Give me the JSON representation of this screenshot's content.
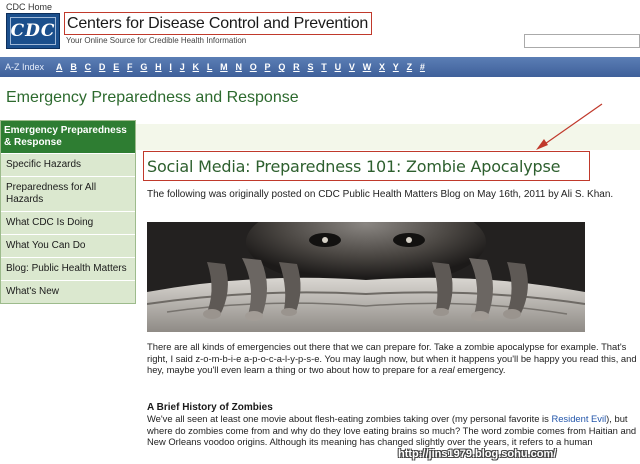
{
  "header": {
    "cdc_home": "CDC Home",
    "logo_text": "CDC",
    "site_title": "Centers for Disease Control and Prevention",
    "tagline": "Your Online Source for Credible Health Information"
  },
  "az_bar": {
    "label": "A-Z Index",
    "letters": [
      "A",
      "B",
      "C",
      "D",
      "E",
      "F",
      "G",
      "H",
      "I",
      "J",
      "K",
      "L",
      "M",
      "N",
      "O",
      "P",
      "Q",
      "R",
      "S",
      "T",
      "U",
      "V",
      "W",
      "X",
      "Y",
      "Z",
      "#"
    ]
  },
  "section_title": "Emergency Preparedness and Response",
  "sidebar": {
    "heading": "Emergency Preparedness & Response",
    "items": [
      {
        "label": "Specific Hazards"
      },
      {
        "label": "Preparedness for All Hazards"
      },
      {
        "label": "What CDC Is Doing"
      },
      {
        "label": "What You Can Do"
      },
      {
        "label": "Blog: Public Health Matters"
      },
      {
        "label": "What's New"
      }
    ]
  },
  "article": {
    "title": "Social Media: Preparedness 101: Zombie Apocalypse",
    "intro": "The following was originally posted on CDC Public Health Matters Blog on May 16th, 2011 by Ali S. Khan.",
    "para1_a": "There are all kinds of emergencies out there that we can prepare for. Take a zombie apocalypse for example. That's right, I said z-o-m-b-i-e a-p-o-c-a-l-y-p-s-e. You may laugh now, but when it happens you'll be happy you read this, and hey, maybe you'll even learn a thing or two about how to prepare for a ",
    "para1_em": "real",
    "para1_b": " emergency.",
    "subheading": "A Brief History of Zombies",
    "para2_a": "We've all seen at least one movie about flesh-eating zombies taking over (my personal favorite is ",
    "para2_link": "Resident Evil",
    "para2_b": "), but where do zombies come from and why do they love eating brains so much? The word zombie comes from Haitian and New Orleans voodoo origins. Although its meaning has changed slightly over the years, it refers to a human"
  },
  "watermark": "http://jins1979.blog.sohu.com/",
  "colors": {
    "az_bar": "#4a6ca6",
    "section_green": "#2d6a2e",
    "sidebar_head": "#2e7d32",
    "highlight_box": "#c0392b"
  }
}
